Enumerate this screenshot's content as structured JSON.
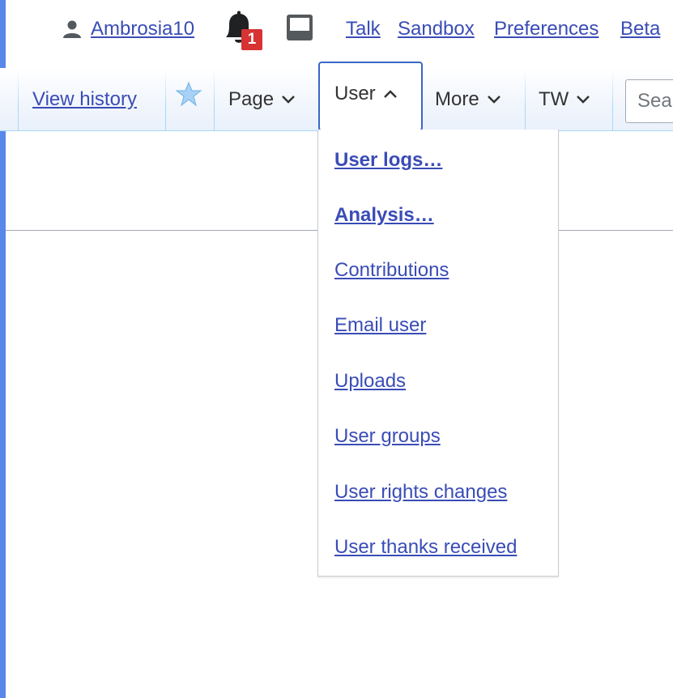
{
  "personal_tools": {
    "username": "Ambrosia10",
    "notifications_count": "1",
    "links": [
      "Talk",
      "Sandbox",
      "Preferences",
      "Beta"
    ]
  },
  "tabs": {
    "view_history": "View history",
    "page": "Page",
    "user": "User",
    "more": "More",
    "tw": "TW"
  },
  "search": {
    "placeholder": "Search"
  },
  "user_menu": {
    "items": [
      {
        "label": "User logs…",
        "bold": true
      },
      {
        "label": "Analysis…",
        "bold": true
      },
      {
        "label": "Contributions",
        "bold": false
      },
      {
        "label": "Email user",
        "bold": false
      },
      {
        "label": "Uploads",
        "bold": false
      },
      {
        "label": "User groups",
        "bold": false
      },
      {
        "label": "User rights changes",
        "bold": false
      },
      {
        "label": "User thanks received",
        "bold": false
      }
    ]
  },
  "colors": {
    "link": "#3a4cb6",
    "frame": "#5a88ea",
    "badge": "#d73333",
    "tab_border": "#a7d7f9"
  }
}
